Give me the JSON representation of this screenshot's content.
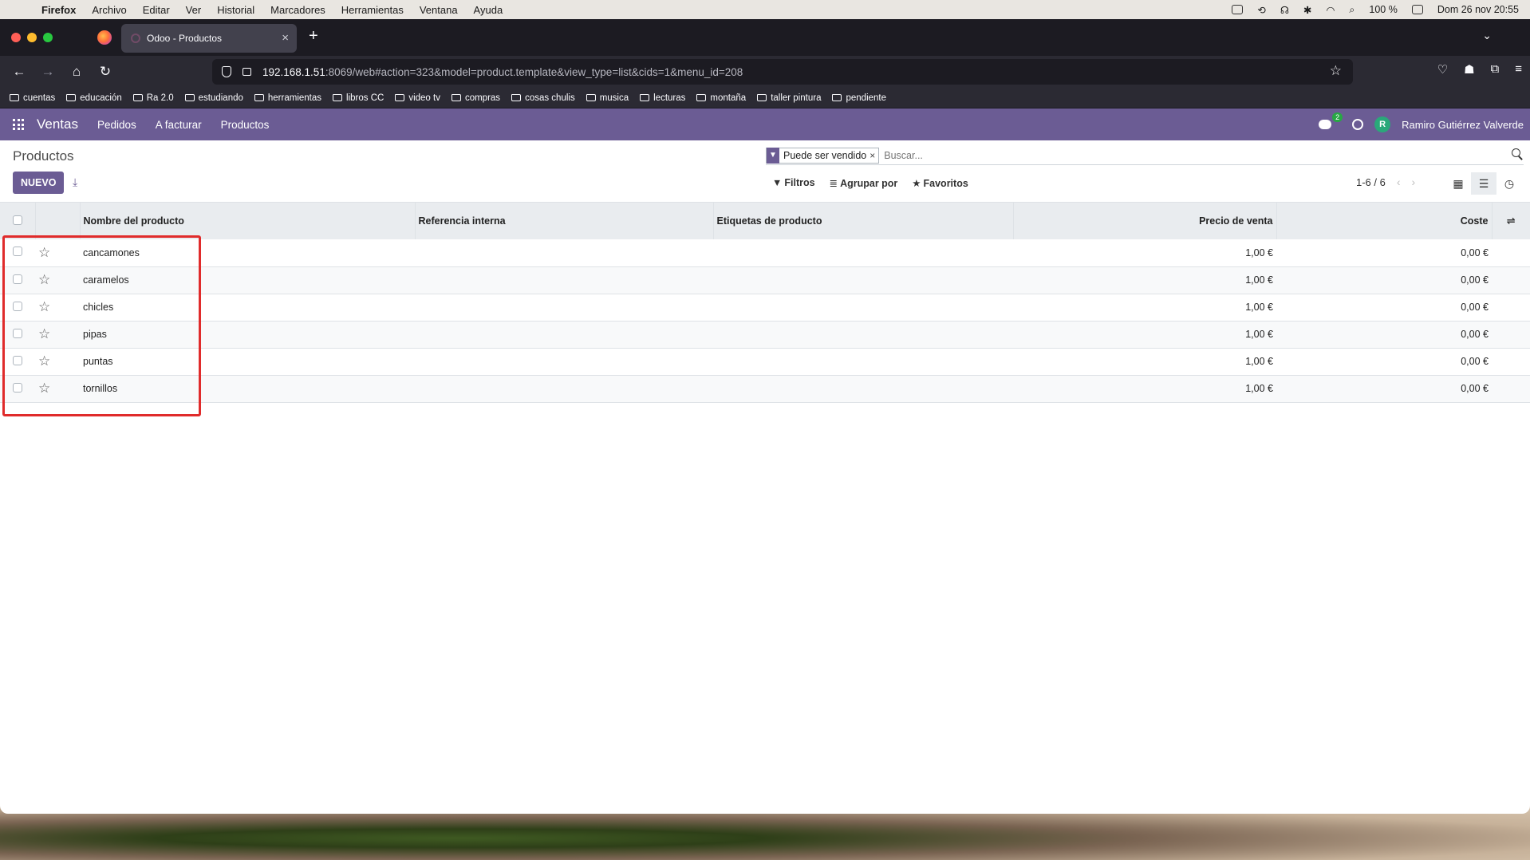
{
  "menubar": {
    "app": "Firefox",
    "items": [
      "Archivo",
      "Editar",
      "Ver",
      "Historial",
      "Marcadores",
      "Herramientas",
      "Ventana",
      "Ayuda"
    ],
    "battery": "100 %",
    "datetime": "Dom 26 nov  20:55"
  },
  "browser": {
    "tab_title": "Odoo - Productos",
    "url_host": "192.168.1.51",
    "url_rest": ":8069/web#action=323&model=product.template&view_type=list&cids=1&menu_id=208",
    "bookmarks": [
      "cuentas",
      "educación",
      "Ra 2.0",
      "estudiando",
      "herramientas",
      "libros CC",
      "video tv",
      "compras",
      "cosas chulis",
      "musica",
      "lecturas",
      "montaña",
      "taller pintura",
      "pendiente"
    ]
  },
  "odoo_nav": {
    "app_name": "Ventas",
    "menus": [
      "Pedidos",
      "A facturar",
      "Productos"
    ],
    "messages_badge": "2",
    "user_initial": "R",
    "user_name": "Ramiro Gutiérrez Valverde"
  },
  "control": {
    "breadcrumb": "Productos",
    "new_button": "NUEVO",
    "facet_label": "Puede ser vendido",
    "facet_remove": "×",
    "search_placeholder": "Buscar...",
    "filters": "Filtros",
    "group_by": "Agrupar por",
    "favorites": "Favoritos",
    "pager": "1-6 / 6"
  },
  "table": {
    "columns": [
      "Nombre del producto",
      "Referencia interna",
      "Etiquetas de producto",
      "Precio de venta",
      "Coste"
    ],
    "rows": [
      {
        "name": "cancamones",
        "ref": "",
        "tags": "",
        "price": "1,00 €",
        "cost": "0,00 €"
      },
      {
        "name": "caramelos",
        "ref": "",
        "tags": "",
        "price": "1,00 €",
        "cost": "0,00 €"
      },
      {
        "name": "chicles",
        "ref": "",
        "tags": "",
        "price": "1,00 €",
        "cost": "0,00 €"
      },
      {
        "name": "pipas",
        "ref": "",
        "tags": "",
        "price": "1,00 €",
        "cost": "0,00 €"
      },
      {
        "name": "puntas",
        "ref": "",
        "tags": "",
        "price": "1,00 €",
        "cost": "0,00 €"
      },
      {
        "name": "tornillos",
        "ref": "",
        "tags": "",
        "price": "1,00 €",
        "cost": "0,00 €"
      }
    ]
  },
  "colors": {
    "odoo_primary": "#6b5c94",
    "highlight": "#e02b2b"
  }
}
